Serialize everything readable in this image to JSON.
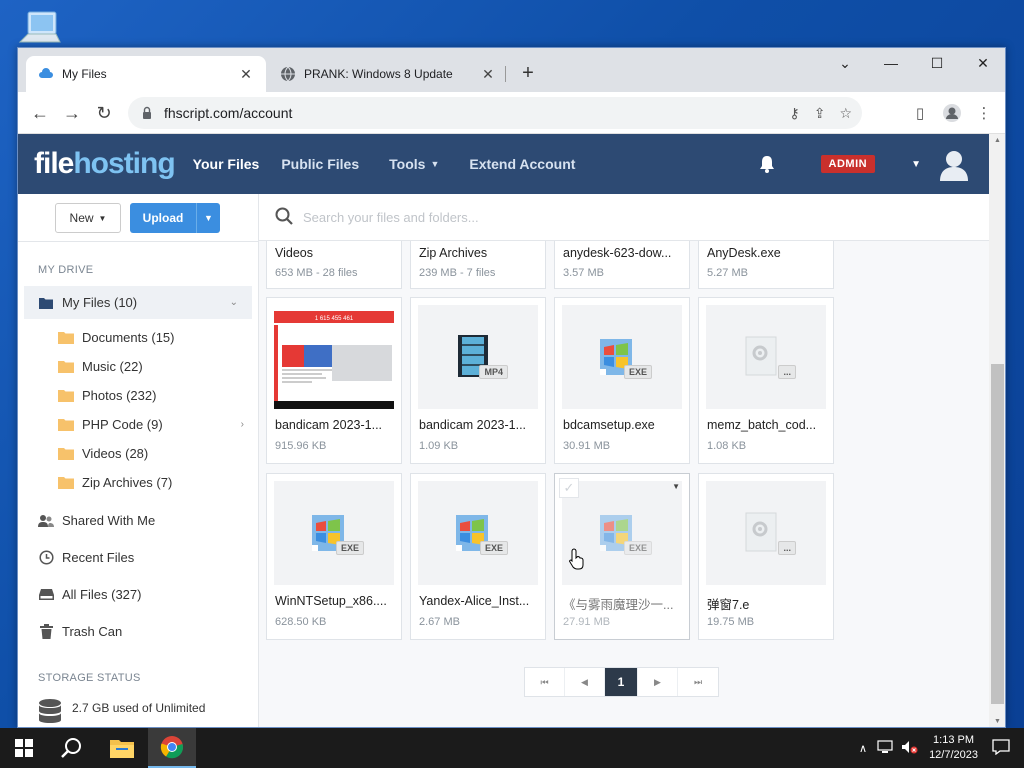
{
  "browser": {
    "tabs": [
      {
        "title": "My Files",
        "active": true
      },
      {
        "title": "PRANK: Windows 8 Update",
        "active": false
      }
    ],
    "url": "fhscript.com/account"
  },
  "site": {
    "logo_part1": "file",
    "logo_part2": "hosting",
    "nav": {
      "your_files": "Your Files",
      "public_files": "Public Files",
      "tools": "Tools",
      "extend_account": "Extend Account"
    },
    "admin_badge": "ADMIN"
  },
  "sidebar": {
    "new_button": "New",
    "upload_button": "Upload",
    "my_drive_header": "MY DRIVE",
    "my_files": "My Files (10)",
    "folders": [
      {
        "label": "Documents (15)"
      },
      {
        "label": "Music (22)"
      },
      {
        "label": "Photos (232)"
      },
      {
        "label": "PHP Code (9)"
      },
      {
        "label": "Videos (28)"
      },
      {
        "label": "Zip Archives (7)"
      }
    ],
    "shared": "Shared With Me",
    "recent": "Recent Files",
    "all_files": "All Files (327)",
    "trash": "Trash Can",
    "storage_header": "STORAGE STATUS",
    "storage_used": "2.7 GB used of Unlimited"
  },
  "main": {
    "search_placeholder": "Search your files and folders...",
    "top_row": [
      {
        "name": "Videos",
        "meta": "653 MB - 28 files"
      },
      {
        "name": "Zip Archives",
        "meta": "239 MB - 7 files"
      },
      {
        "name": "anydesk-623-dow...",
        "meta": "3.57 MB"
      },
      {
        "name": "AnyDesk.exe",
        "meta": "5.27 MB"
      }
    ],
    "row2": [
      {
        "name": "bandicam 2023-1...",
        "meta": "915.96 KB",
        "thumb": "screenshot"
      },
      {
        "name": "bandicam 2023-1...",
        "meta": "1.09 KB",
        "thumb": "mp4",
        "badge": "MP4"
      },
      {
        "name": "bdcamsetup.exe",
        "meta": "30.91 MB",
        "thumb": "exe",
        "badge": "EXE"
      },
      {
        "name": "memz_batch_cod...",
        "meta": "1.08 KB",
        "thumb": "generic",
        "badge": "..."
      }
    ],
    "row3": [
      {
        "name": "WinNTSetup_x86....",
        "meta": "628.50 KB",
        "thumb": "exe",
        "badge": "EXE"
      },
      {
        "name": "Yandex-Alice_Inst...",
        "meta": "2.67 MB",
        "thumb": "exe",
        "badge": "EXE"
      },
      {
        "name": "《与雾雨魔理沙一...",
        "meta": "27.91 MB",
        "thumb": "exe",
        "badge": "EXE"
      },
      {
        "name": "弹窗7.e",
        "meta": "19.75 MB",
        "thumb": "generic",
        "badge": "..."
      }
    ],
    "pagination": {
      "current": "1"
    }
  },
  "screenshot_thumb": {
    "text": "1 615 455 461"
  },
  "taskbar": {
    "time": "1:13 PM",
    "date": "12/7/2023"
  }
}
